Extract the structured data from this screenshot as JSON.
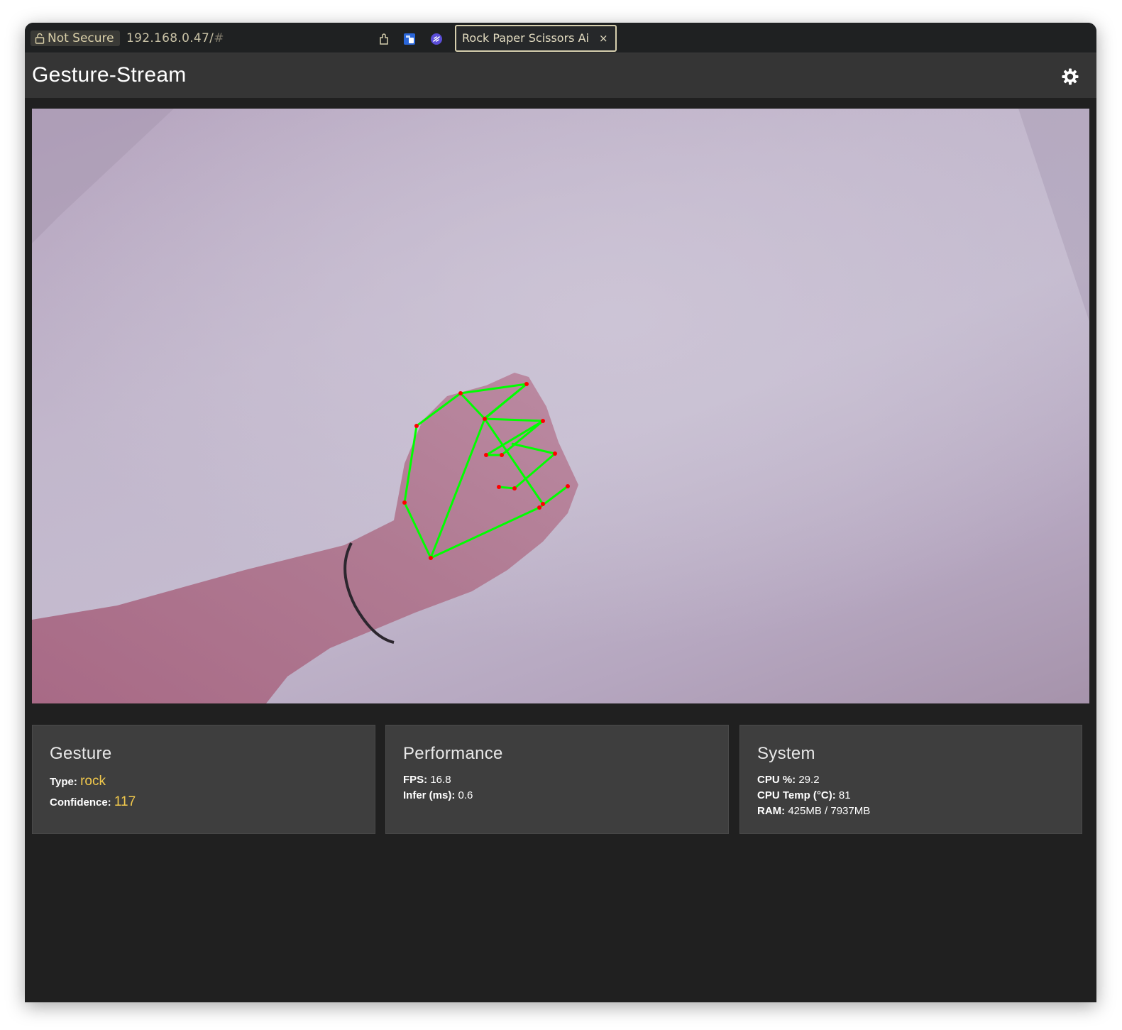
{
  "browser": {
    "security_label": "Not Secure",
    "url_host": "192.168.0.47/",
    "url_hash": "#",
    "tab_title": "Rock Paper Scissors Ai",
    "tab_close": "×"
  },
  "app": {
    "title": "Gesture-Stream"
  },
  "cards": {
    "gesture": {
      "title": "Gesture",
      "type_label": "Type:",
      "type_value": "rock",
      "confidence_label": "Confidence:",
      "confidence_value": "117"
    },
    "performance": {
      "title": "Performance",
      "fps_label": "FPS:",
      "fps_value": "16.8",
      "infer_label": "Infer (ms):",
      "infer_value": "0.6"
    },
    "system": {
      "title": "System",
      "cpu_label": "CPU %:",
      "cpu_value": "29.2",
      "temp_label": "CPU Temp (°C):",
      "temp_value": "81",
      "ram_label": "RAM:",
      "ram_value": "425MB / 7937MB"
    }
  },
  "colors": {
    "accent": "#f2c94c",
    "landmark_line": "#00ff00",
    "landmark_point": "#ff0000"
  },
  "icons": [
    "lock-icon",
    "extension-icon",
    "shield-icon",
    "link-icon",
    "close-icon",
    "settings-gear-icon"
  ]
}
